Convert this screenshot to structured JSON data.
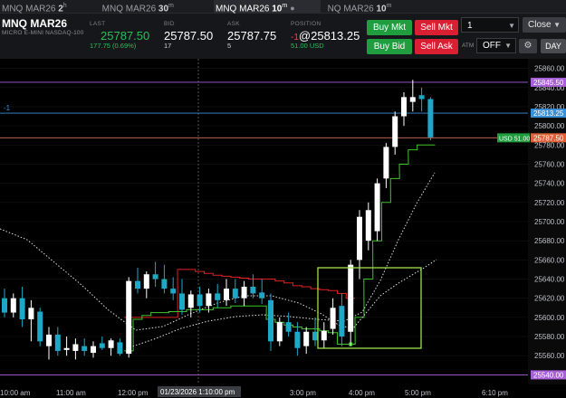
{
  "tabs": [
    {
      "symbol": "MNQ MAR26",
      "interval": "2",
      "sup": "h"
    },
    {
      "symbol": "MNQ MAR26",
      "interval": "30",
      "sup": "m"
    },
    {
      "symbol": "MNQ MAR26",
      "interval": "10",
      "sup": "m",
      "active": true
    },
    {
      "symbol": "NQ MAR26",
      "interval": "10",
      "sup": "m"
    }
  ],
  "instrument": {
    "symbol": "MNQ MAR26",
    "description": "MICRO E-MINI NASDAQ-100"
  },
  "quote": {
    "last_label": "LAST",
    "last": "25787.50",
    "change": "177.75 (0.69%)",
    "bid_label": "BID",
    "bid": "25787.50",
    "bid_size": "17",
    "ask_label": "ASK",
    "ask": "25787.75",
    "ask_size": "5",
    "position_label": "POSITION",
    "position_qty": "-1",
    "position_price": "@25813.25",
    "position_pnl": "51.00 USD"
  },
  "orders": {
    "buy_mkt": "Buy Mkt",
    "sell_mkt": "Sell Mkt",
    "buy_bid": "Buy Bid",
    "sell_ask": "Sell Ask"
  },
  "quantity": "1",
  "close_label": "Close",
  "atm_label": "ATM",
  "atm_value": "OFF",
  "day_label": "DAY",
  "chart": {
    "price_labels": [
      "25860.00",
      "25840.00",
      "25820.00",
      "25800.00",
      "25780.00",
      "25760.00",
      "25740.00",
      "25720.00",
      "25700.00",
      "25680.00",
      "25660.00",
      "25640.00",
      "25620.00",
      "25600.00",
      "25580.00",
      "25560.00",
      "25540.00"
    ],
    "time_labels": [
      "10:00 am",
      "11:00 am",
      "12:00 pm",
      "3:00 pm",
      "4:00 pm",
      "5:00 pm",
      "6:10 pm"
    ],
    "crosshair_time": "01/23/2026 1:10:00 pm",
    "tags": {
      "top_line": "25845.50",
      "position": "25813.25",
      "last": "25787.50",
      "pnl": "USD 51.00",
      "bottom_line": "25540.00"
    },
    "position_marker": "-1",
    "colors": {
      "up": "#ffffff",
      "down": "#1da8c8",
      "ma_red": "#e02020",
      "ma_green": "#3ec62a",
      "box": "#9be24a"
    }
  },
  "chart_data": {
    "type": "candlestick",
    "ylim": [
      25530,
      25870
    ],
    "candles": [
      {
        "o": 25620,
        "h": 25630,
        "l": 25600,
        "c": 25605
      },
      {
        "o": 25605,
        "h": 25625,
        "l": 25600,
        "c": 25620
      },
      {
        "o": 25620,
        "h": 25632,
        "l": 25590,
        "c": 25598
      },
      {
        "o": 25598,
        "h": 25618,
        "l": 25575,
        "c": 25610
      },
      {
        "o": 25606,
        "h": 25610,
        "l": 25570,
        "c": 25575
      },
      {
        "o": 25570,
        "h": 25590,
        "l": 25556,
        "c": 25582
      },
      {
        "o": 25582,
        "h": 25590,
        "l": 25560,
        "c": 25565
      },
      {
        "o": 25566,
        "h": 25580,
        "l": 25560,
        "c": 25568
      },
      {
        "o": 25565,
        "h": 25578,
        "l": 25556,
        "c": 25572
      },
      {
        "o": 25570,
        "h": 25578,
        "l": 25560,
        "c": 25565
      },
      {
        "o": 25563,
        "h": 25575,
        "l": 25558,
        "c": 25570
      },
      {
        "o": 25573,
        "h": 25580,
        "l": 25566,
        "c": 25568
      },
      {
        "o": 25568,
        "h": 25578,
        "l": 25560,
        "c": 25576
      },
      {
        "o": 25574,
        "h": 25578,
        "l": 25560,
        "c": 25562
      },
      {
        "o": 25562,
        "h": 25642,
        "l": 25558,
        "c": 25638
      },
      {
        "o": 25638,
        "h": 25652,
        "l": 25625,
        "c": 25630
      },
      {
        "o": 25630,
        "h": 25648,
        "l": 25620,
        "c": 25645
      },
      {
        "o": 25645,
        "h": 25658,
        "l": 25632,
        "c": 25640
      },
      {
        "o": 25640,
        "h": 25655,
        "l": 25625,
        "c": 25630
      },
      {
        "o": 25630,
        "h": 25642,
        "l": 25618,
        "c": 25625
      },
      {
        "o": 25625,
        "h": 25640,
        "l": 25603,
        "c": 25608
      },
      {
        "o": 25610,
        "h": 25628,
        "l": 25600,
        "c": 25624
      },
      {
        "o": 25624,
        "h": 25632,
        "l": 25605,
        "c": 25612
      },
      {
        "o": 25612,
        "h": 25630,
        "l": 25605,
        "c": 25625
      },
      {
        "o": 25625,
        "h": 25635,
        "l": 25610,
        "c": 25618
      },
      {
        "o": 25618,
        "h": 25640,
        "l": 25612,
        "c": 25630
      },
      {
        "o": 25630,
        "h": 25640,
        "l": 25615,
        "c": 25620
      },
      {
        "o": 25620,
        "h": 25638,
        "l": 25612,
        "c": 25632
      },
      {
        "o": 25632,
        "h": 25645,
        "l": 25620,
        "c": 25625
      },
      {
        "o": 25626,
        "h": 25640,
        "l": 25614,
        "c": 25620
      },
      {
        "o": 25618,
        "h": 25625,
        "l": 25565,
        "c": 25575
      },
      {
        "o": 25575,
        "h": 25600,
        "l": 25570,
        "c": 25595
      },
      {
        "o": 25595,
        "h": 25605,
        "l": 25580,
        "c": 25585
      },
      {
        "o": 25585,
        "h": 25595,
        "l": 25560,
        "c": 25568
      },
      {
        "o": 25570,
        "h": 25590,
        "l": 25562,
        "c": 25585
      },
      {
        "o": 25585,
        "h": 25600,
        "l": 25570,
        "c": 25576
      },
      {
        "o": 25576,
        "h": 25595,
        "l": 25568,
        "c": 25586
      },
      {
        "o": 25588,
        "h": 25620,
        "l": 25582,
        "c": 25610
      },
      {
        "o": 25612,
        "h": 25625,
        "l": 25570,
        "c": 25580
      },
      {
        "o": 25585,
        "h": 25660,
        "l": 25570,
        "c": 25655
      },
      {
        "o": 25660,
        "h": 25712,
        "l": 25640,
        "c": 25705
      },
      {
        "o": 25680,
        "h": 25720,
        "l": 25670,
        "c": 25712
      },
      {
        "o": 25690,
        "h": 25745,
        "l": 25680,
        "c": 25740
      },
      {
        "o": 25745,
        "h": 25782,
        "l": 25735,
        "c": 25778
      },
      {
        "o": 25778,
        "h": 25815,
        "l": 25770,
        "c": 25810
      },
      {
        "o": 25810,
        "h": 25835,
        "l": 25800,
        "c": 25830
      },
      {
        "o": 25825,
        "h": 25848,
        "l": 25815,
        "c": 25830
      },
      {
        "o": 25832,
        "h": 25840,
        "l": 25815,
        "c": 25828
      },
      {
        "o": 25828,
        "h": 25830,
        "l": 25785,
        "c": 25788
      }
    ]
  }
}
